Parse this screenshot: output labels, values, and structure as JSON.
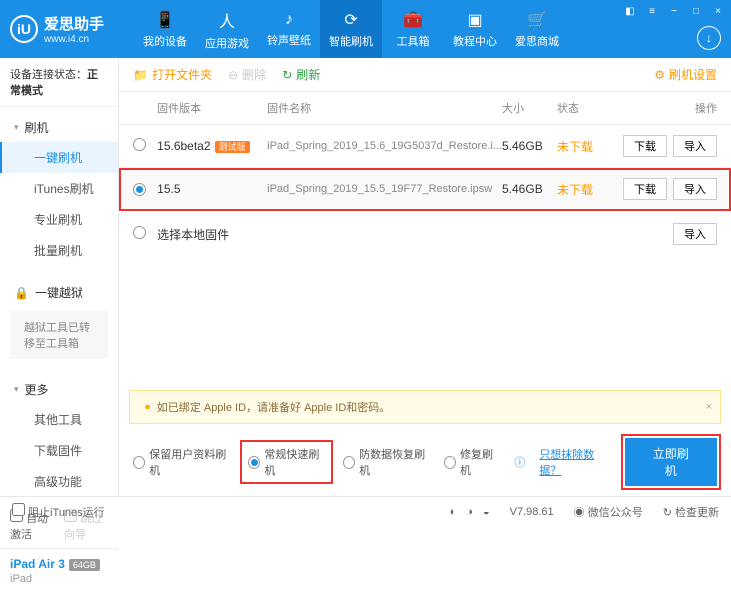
{
  "brand": {
    "name": "爱思助手",
    "sub": "www.i4.cn",
    "logo_letter": "iU"
  },
  "nav": [
    {
      "label": "我的设备",
      "icon": "📱"
    },
    {
      "label": "应用游戏",
      "icon": "人"
    },
    {
      "label": "铃声壁纸",
      "icon": "♪"
    },
    {
      "label": "智能刷机",
      "icon": "⟳"
    },
    {
      "label": "工具箱",
      "icon": "🧰"
    },
    {
      "label": "教程中心",
      "icon": "▣"
    },
    {
      "label": "爱思商城",
      "icon": "🛒"
    }
  ],
  "conn_status_label": "设备连接状态：",
  "conn_status_value": "正常模式",
  "sidebar": {
    "flash_head": "刷机",
    "flash_items": [
      "一键刷机",
      "iTunes刷机",
      "专业刷机",
      "批量刷机"
    ],
    "jailbreak_head": "一键越狱",
    "jailbreak_note": "越狱工具已转移至工具箱",
    "more_head": "更多",
    "more_items": [
      "其他工具",
      "下载固件",
      "高级功能"
    ],
    "auto_activate": "自动激活",
    "skip_guide": "跳过向导"
  },
  "device": {
    "name": "iPad Air 3",
    "storage": "64GB",
    "type": "iPad"
  },
  "toolbar": {
    "open_folder": "打开文件夹",
    "delete": "删除",
    "refresh": "刷新",
    "settings": "刷机设置"
  },
  "table": {
    "headers": {
      "version": "固件版本",
      "name": "固件名称",
      "size": "大小",
      "status": "状态",
      "ops": "操作"
    },
    "rows": [
      {
        "version": "15.6beta2",
        "tag": "测试版",
        "name": "iPad_Spring_2019_15.6_19G5037d_Restore.i...",
        "size": "5.46GB",
        "status": "未下载",
        "selected": false
      },
      {
        "version": "15.5",
        "tag": "",
        "name": "iPad_Spring_2019_15.5_19F77_Restore.ipsw",
        "size": "5.46GB",
        "status": "未下载",
        "selected": true
      }
    ],
    "local_firmware": "选择本地固件",
    "btn_download": "下载",
    "btn_import": "导入"
  },
  "warning": "如已绑定 Apple ID，请准备好 Apple ID和密码。",
  "options": {
    "keep_data": "保留用户资料刷机",
    "normal_fast": "常规快速刷机",
    "anti_recovery": "防数据恢复刷机",
    "repair": "修复刷机",
    "exclude_link": "只想抹除数据？",
    "flash_now": "立即刷机"
  },
  "footer": {
    "block_itunes": "阻止iTunes运行",
    "version": "V7.98.61",
    "wechat": "微信公众号",
    "check_update": "检查更新"
  }
}
